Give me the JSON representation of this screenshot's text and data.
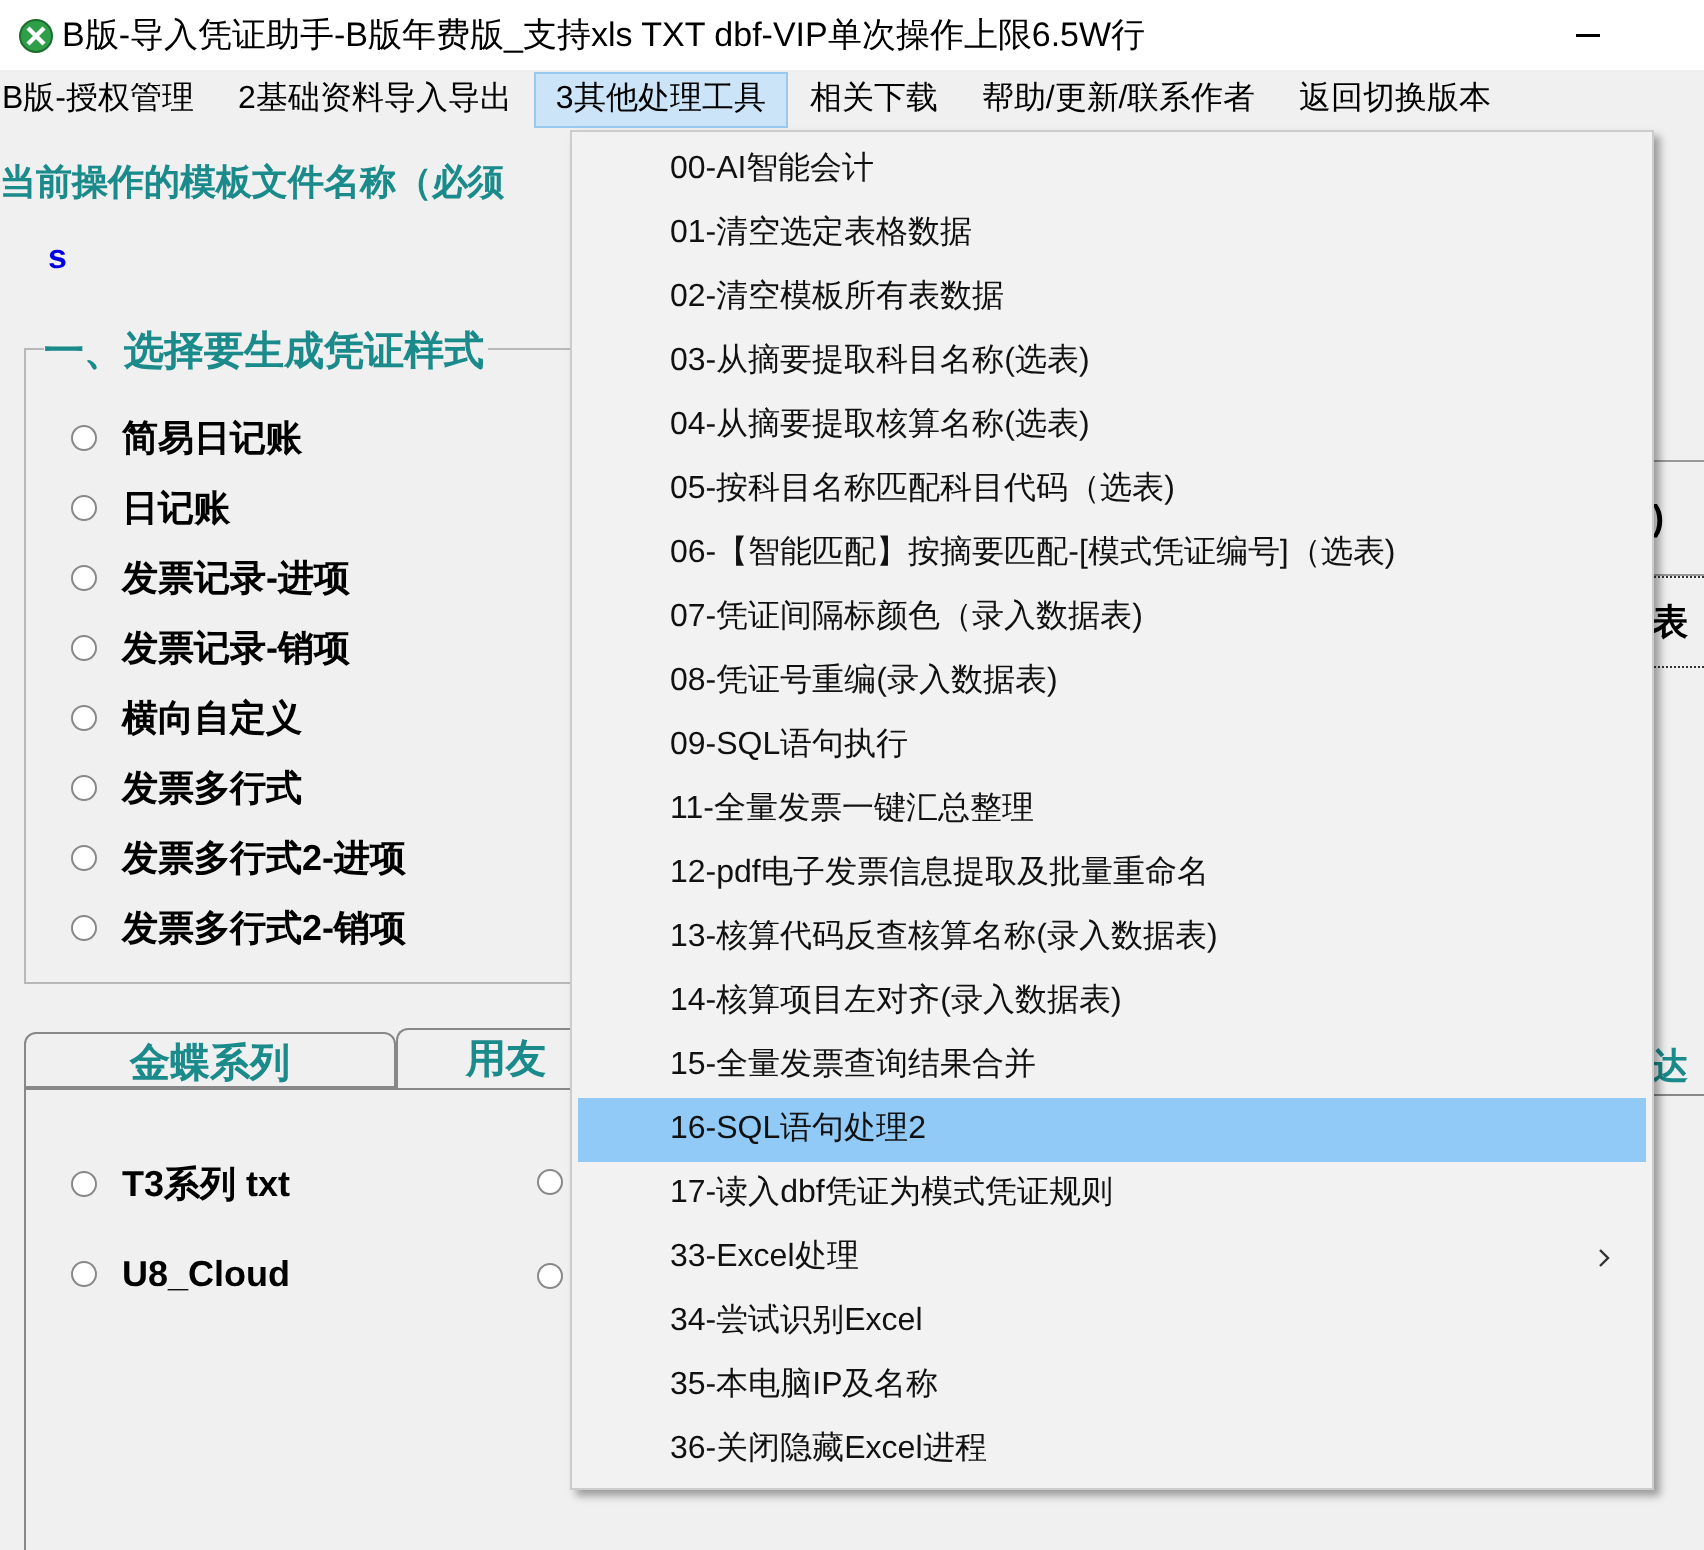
{
  "window": {
    "title": "B版-导入凭证助手-B版年费版_支持xls TXT dbf-VIP单次操作上限6.5W行"
  },
  "menubar": [
    {
      "label": "B版-授权管理",
      "selected": false
    },
    {
      "label": "2基础资料导入导出",
      "selected": false
    },
    {
      "label": "3其他处理工具",
      "selected": true
    },
    {
      "label": "相关下载",
      "selected": false
    },
    {
      "label": "帮助/更新/联系作者",
      "selected": false
    },
    {
      "label": "返回切换版本",
      "selected": false
    }
  ],
  "template_heading": "当前操作的模板文件名称（必须",
  "template_value": "s",
  "right_edge": {
    "button_fragment_1": ")",
    "button_fragment_2": "表",
    "tab_fragment": "达"
  },
  "voucher_style_group": {
    "title": "一、选择要生成凭证样式",
    "options": [
      {
        "label": "简易日记账",
        "selected": false
      },
      {
        "label": "日记账",
        "selected": false
      },
      {
        "label": "发票记录-进项",
        "selected": false
      },
      {
        "label": "发票记录-销项",
        "selected": false
      },
      {
        "label": "横向自定义",
        "selected": false
      },
      {
        "label": "发票多行式",
        "selected": false
      },
      {
        "label": "发票多行式2-进项",
        "selected": false
      },
      {
        "label": "发票多行式2-销项",
        "selected": false
      }
    ]
  },
  "software_tabs": [
    {
      "label": "金蝶系列",
      "selected": false
    },
    {
      "label": "用友",
      "selected": true
    }
  ],
  "software_options": [
    {
      "label": "T3系列 txt",
      "selected": false
    },
    {
      "label": "U8_Cloud",
      "selected": false
    }
  ],
  "hidden_label_radios": [
    {
      "selected": false
    },
    {
      "selected": false
    }
  ],
  "dropdown_menu": [
    {
      "label": "00-AI智能会计",
      "selected": false,
      "submenu": false
    },
    {
      "label": "01-清空选定表格数据",
      "selected": false,
      "submenu": false
    },
    {
      "label": "02-清空模板所有表数据",
      "selected": false,
      "submenu": false
    },
    {
      "label": "03-从摘要提取科目名称(选表)",
      "selected": false,
      "submenu": false
    },
    {
      "label": "04-从摘要提取核算名称(选表)",
      "selected": false,
      "submenu": false
    },
    {
      "label": "05-按科目名称匹配科目代码（选表)",
      "selected": false,
      "submenu": false
    },
    {
      "label": "06-【智能匹配】按摘要匹配-[模式凭证编号]（选表)",
      "selected": false,
      "submenu": false
    },
    {
      "label": "07-凭证间隔标颜色（录入数据表)",
      "selected": false,
      "submenu": false
    },
    {
      "label": "08-凭证号重编(录入数据表)",
      "selected": false,
      "submenu": false
    },
    {
      "label": "09-SQL语句执行",
      "selected": false,
      "submenu": false
    },
    {
      "label": "11-全量发票一键汇总整理",
      "selected": false,
      "submenu": false
    },
    {
      "label": "12-pdf电子发票信息提取及批量重命名",
      "selected": false,
      "submenu": false
    },
    {
      "label": "13-核算代码反查核算名称(录入数据表)",
      "selected": false,
      "submenu": false
    },
    {
      "label": "14-核算项目左对齐(录入数据表)",
      "selected": false,
      "submenu": false
    },
    {
      "label": "15-全量发票查询结果合并",
      "selected": false,
      "submenu": false
    },
    {
      "label": "16-SQL语句处理2",
      "selected": true,
      "submenu": false
    },
    {
      "label": "17-读入dbf凭证为模式凭证规则",
      "selected": false,
      "submenu": false
    },
    {
      "label": "33-Excel处理",
      "selected": false,
      "submenu": true
    },
    {
      "label": "34-尝试识别Excel",
      "selected": false,
      "submenu": false
    },
    {
      "label": "35-本电脑IP及名称",
      "selected": false,
      "submenu": false
    },
    {
      "label": "36-关闭隐藏Excel进程",
      "selected": false,
      "submenu": false
    }
  ]
}
